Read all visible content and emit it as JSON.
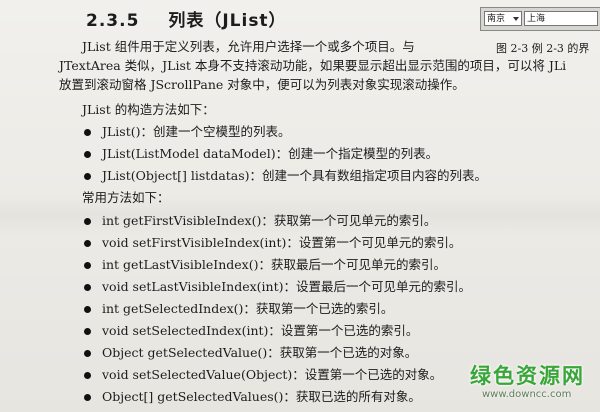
{
  "heading": {
    "number": "2.3.5",
    "title": "列表（JList）"
  },
  "ui_widget": {
    "combo_value": "南京",
    "text_value": "上海"
  },
  "figure_caption": "图 2-3   例 2-3 的界",
  "intro": {
    "line1": "JList 组件用于定义列表，允许用户选择一个或多个项目。与",
    "line2": "JTextArea 类似，JList 本身不支持滚动功能，如果要显示超出显示范围的项目，可以将 JLi",
    "line3": "放置到滚动窗格 JScrollPane 对象中，便可以为列表对象实现滚动操作。"
  },
  "constructors_heading": "JList 的构造方法如下：",
  "constructors": [
    "JList()：创建一个空模型的列表。",
    "JList(ListModel dataModel)：创建一个指定模型的列表。",
    "JList(Object[] listdatas)：创建一个具有数组指定项目内容的列表。"
  ],
  "methods_heading": "常用方法如下：",
  "methods": [
    "int getFirstVisibleIndex()：获取第一个可见单元的索引。",
    "void setFirstVisibleIndex(int)：设置第一个可见单元的索引。",
    "int getLastVisibleIndex()：获取最后一个可见单元的索引。",
    "void setLastVisibleIndex(int)：设置最后一个可见单元的索引。",
    "int getSelectedIndex()：获取第一个已选的索引。",
    "void setSelectedIndex(int)：设置第一个已选的索引。",
    "Object getSelectedValue()：获取第一个已选的对象。",
    "void setSelectedValue(Object)：设置第一个已选的对象。",
    "Object[] getSelectedValues()：获取已选的所有对象。"
  ],
  "watermark": {
    "name": "绿色资源网",
    "url": "www.downcc.com"
  }
}
